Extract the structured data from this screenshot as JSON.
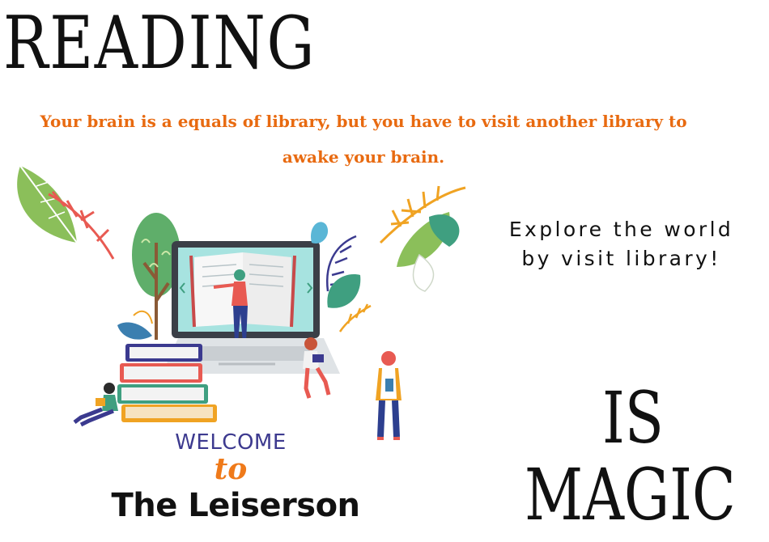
{
  "title": "READING",
  "tagline": "Your brain is a equals of library, but you have to visit another library to awake your brain.",
  "explore": {
    "line1": "Explore the world",
    "line2": "by visit library!"
  },
  "magic": {
    "word1": "IS",
    "word2": "MAGIC"
  },
  "welcome": {
    "line1": "WELCOME",
    "line2": "to",
    "line3": "The Leiserson"
  },
  "colors": {
    "accent_orange": "#e86a10",
    "welcome_purple": "#3d3a8f",
    "text_black": "#111111"
  },
  "icons": [
    "leaf-decoration-icon",
    "laptop-reading-icon",
    "book-stack-icon",
    "reader-person-icon"
  ]
}
